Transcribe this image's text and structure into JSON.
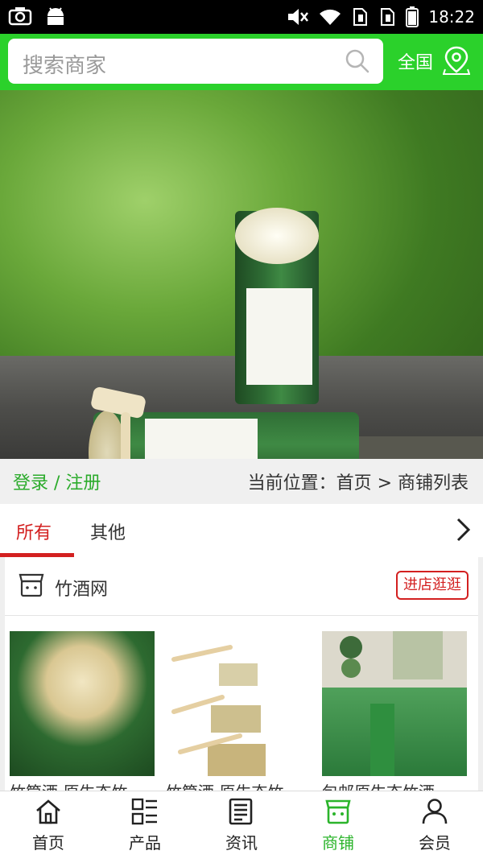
{
  "status_bar": {
    "time": "18:22"
  },
  "header": {
    "search_placeholder": "搜索商家",
    "region_label": "全国"
  },
  "breadcrumb": {
    "login_register": "登录 / 注册",
    "current_location": "当前位置：首页 > 商铺列表"
  },
  "tabs": [
    {
      "label": "所有",
      "active": true
    },
    {
      "label": "其他",
      "active": false
    }
  ],
  "shop": {
    "name": "竹酒网",
    "enter_button": "进店逛逛",
    "products": [
      {
        "title": "竹筒酒 原生态竹..."
      },
      {
        "title": "竹筒酒 原生态竹..."
      },
      {
        "title": "包邮原生态竹酒 ..."
      }
    ]
  },
  "bottom_nav": [
    {
      "label": "首页",
      "icon": "home-icon"
    },
    {
      "label": "产品",
      "icon": "grid-list-icon"
    },
    {
      "label": "资讯",
      "icon": "news-icon"
    },
    {
      "label": "商铺",
      "icon": "store-icon",
      "active": true
    },
    {
      "label": "会员",
      "icon": "user-icon"
    }
  ],
  "colors": {
    "brand_green": "#2bd12b",
    "accent_red": "#d32020",
    "active_nav": "#2bb42b"
  }
}
